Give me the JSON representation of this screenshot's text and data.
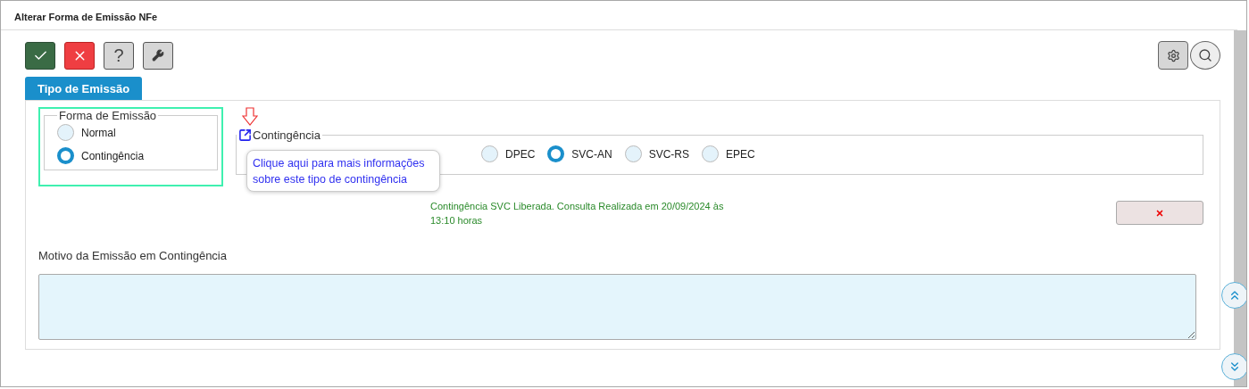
{
  "window": {
    "title": "Alterar Forma de Emissão NFe"
  },
  "toolbar": {
    "buttons": [
      {
        "kind": "confirm"
      },
      {
        "kind": "cancel"
      },
      {
        "kind": "help",
        "label": "?"
      },
      {
        "kind": "tools"
      }
    ],
    "right_buttons": [
      {
        "kind": "settings"
      },
      {
        "kind": "search"
      }
    ]
  },
  "tabs": [
    {
      "label": "Tipo de Emissão",
      "selected": true
    }
  ],
  "forma_de_emissao": {
    "legend": "Forma de Emissão",
    "options": [
      {
        "label": "Normal",
        "selected": false
      },
      {
        "label": "Contingência",
        "selected": true
      }
    ]
  },
  "contingencia": {
    "legend": "Contingência",
    "options": [
      {
        "label": "DPEC",
        "selected": false
      },
      {
        "label": "SVC-AN",
        "selected": true
      },
      {
        "label": "SVC-RS",
        "selected": false
      },
      {
        "label": "EPEC",
        "selected": false
      }
    ],
    "tooltip": "Clique aqui para mais informações sobre este tipo de contingência",
    "status": "Contingência SVC Liberada. Consulta Realizada em 20/09/2024 às 13:10 horas"
  },
  "motivo": {
    "label": "Motivo da Emissão em Contingência"
  }
}
